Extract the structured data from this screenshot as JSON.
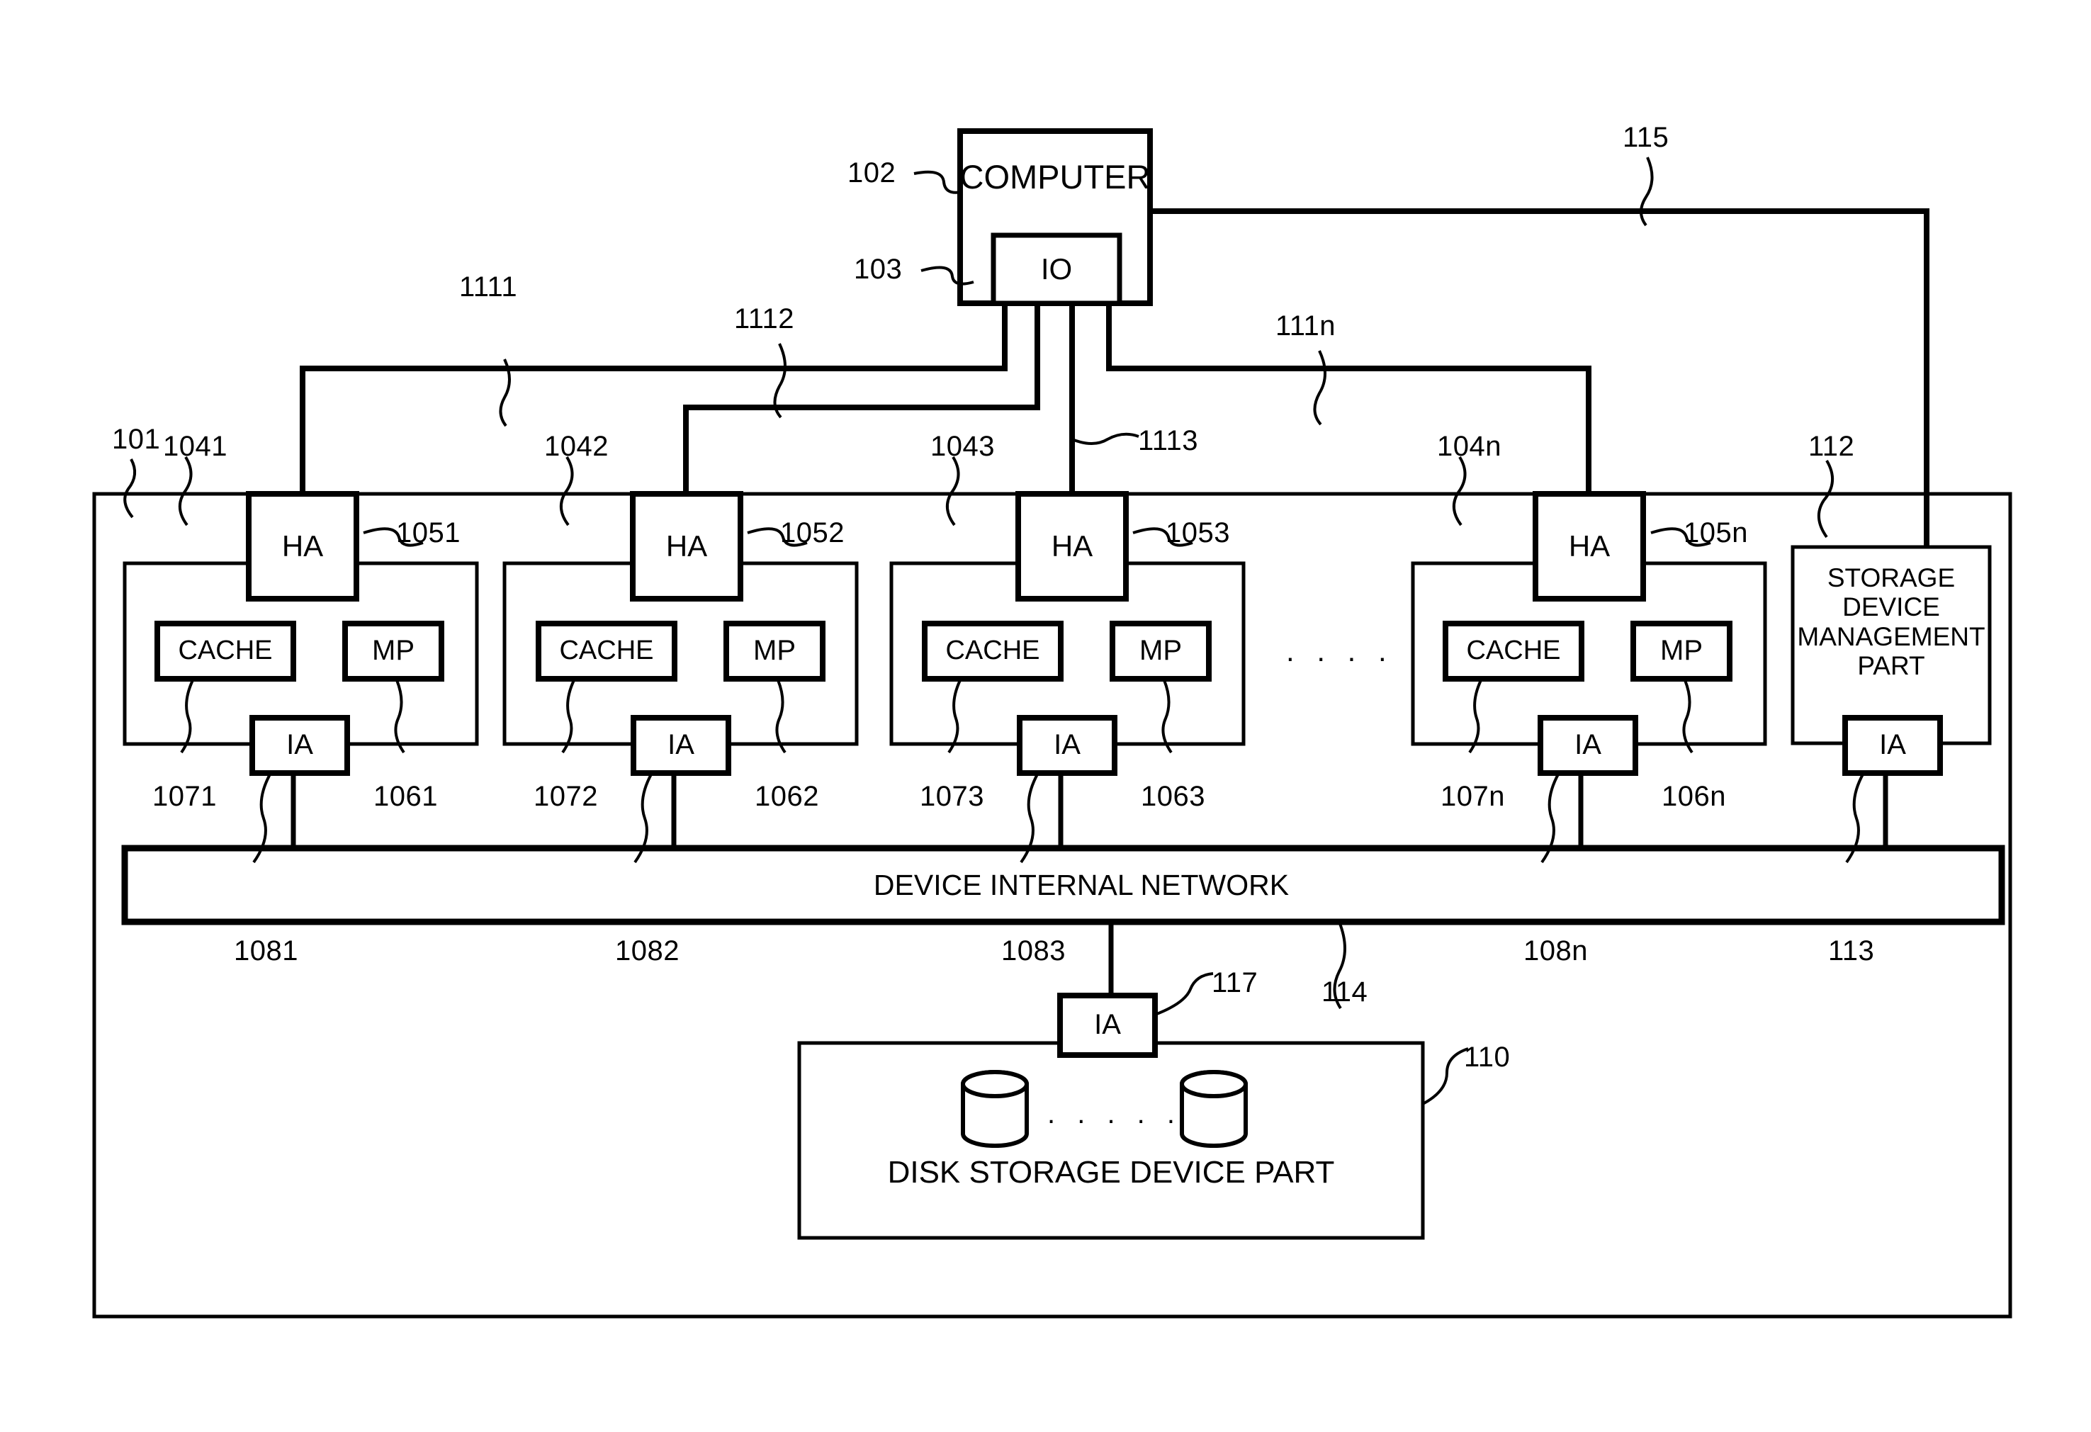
{
  "diagram": {
    "title": "Storage system block diagram",
    "ink_color": "#000000",
    "background": "#ffffff"
  },
  "computer": {
    "label": "COMPUTER",
    "ref": "102",
    "io": {
      "label": "IO",
      "ref": "103"
    }
  },
  "storage_system": {
    "ref": "101"
  },
  "clusters": [
    {
      "ref": "1041",
      "ha": {
        "label": "HA",
        "ref": "1051"
      },
      "cache": {
        "label": "CACHE",
        "ref": "1071"
      },
      "mp": {
        "label": "MP",
        "ref": "1061"
      },
      "ia": {
        "label": "IA",
        "ref": "1081"
      },
      "link_ref": "1111"
    },
    {
      "ref": "1042",
      "ha": {
        "label": "HA",
        "ref": "1052"
      },
      "cache": {
        "label": "CACHE",
        "ref": "1072"
      },
      "mp": {
        "label": "MP",
        "ref": "1062"
      },
      "ia": {
        "label": "IA",
        "ref": "1082"
      },
      "link_ref": "1112"
    },
    {
      "ref": "1043",
      "ha": {
        "label": "HA",
        "ref": "1053"
      },
      "cache": {
        "label": "CACHE",
        "ref": "1073"
      },
      "mp": {
        "label": "MP",
        "ref": "1063"
      },
      "ia": {
        "label": "IA",
        "ref": "1083"
      },
      "link_ref": "1113"
    },
    {
      "ref": "104n",
      "ha": {
        "label": "HA",
        "ref": "105n"
      },
      "cache": {
        "label": "CACHE",
        "ref": "107n"
      },
      "mp": {
        "label": "MP",
        "ref": "106n"
      },
      "ia": {
        "label": "IA",
        "ref": "108n"
      },
      "link_ref": "111n"
    }
  ],
  "cluster_ellipsis": ". . . . .",
  "management": {
    "label": "STORAGE\nDEVICE\nMANAGEMENT\nPART",
    "line1": "STORAGE",
    "line2": "DEVICE",
    "line3": "MANAGEMENT",
    "line4": "PART",
    "ref": "112",
    "ia": {
      "label": "IA",
      "ref": "113"
    },
    "link_ref": "115"
  },
  "network": {
    "label": "DEVICE INTERNAL NETWORK",
    "ref": "114"
  },
  "disk_part": {
    "label": "DISK STORAGE DEVICE PART",
    "ref": "110",
    "ia": {
      "label": "IA",
      "ref": "117"
    },
    "disk_ellipsis": ". . . . ."
  }
}
